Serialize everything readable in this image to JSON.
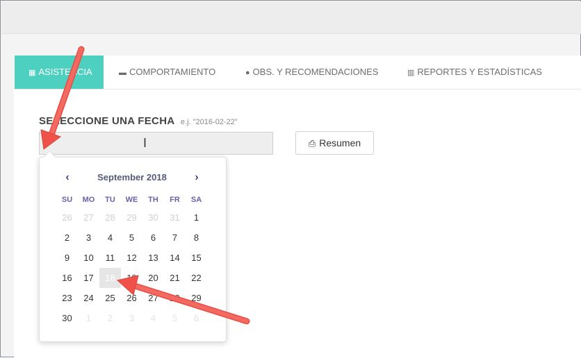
{
  "tabs": [
    {
      "label": "ASISTENCIA",
      "icon": "calendar-icon",
      "active": true
    },
    {
      "label": "COMPORTAMIENTO",
      "icon": "comment-icon",
      "active": false
    },
    {
      "label": "OBS. Y RECOMENDACIONES",
      "icon": "comments-icon",
      "active": false
    },
    {
      "label": "REPORTES Y ESTADÍSTICAS",
      "icon": "bar-chart-icon",
      "active": false
    }
  ],
  "form": {
    "label": "SELECCIONE UNA FECHA",
    "hint": "e.j. \"2016-02-22\"",
    "date_value": "",
    "resumen_label": "Resumen"
  },
  "datepicker": {
    "title": "September 2018",
    "prev": "‹",
    "next": "›",
    "days_of_week": [
      "SU",
      "MO",
      "TU",
      "WE",
      "TH",
      "FR",
      "SA"
    ],
    "weeks": [
      [
        "26",
        "27",
        "28",
        "29",
        "30",
        "31",
        "1"
      ],
      [
        "2",
        "3",
        "4",
        "5",
        "6",
        "7",
        "8"
      ],
      [
        "9",
        "10",
        "11",
        "12",
        "13",
        "14",
        "15"
      ],
      [
        "16",
        "17",
        "18",
        "19",
        "20",
        "21",
        "22"
      ],
      [
        "23",
        "24",
        "25",
        "26",
        "27",
        "28",
        "29"
      ],
      [
        "30",
        "1",
        "2",
        "3",
        "4",
        "5",
        "6"
      ]
    ],
    "selected": "18"
  },
  "colors": {
    "tab_active_bg": "#4dd0c0",
    "annotation_arrow": "#f0524a",
    "datepicker_accent": "#4a3f8c"
  }
}
